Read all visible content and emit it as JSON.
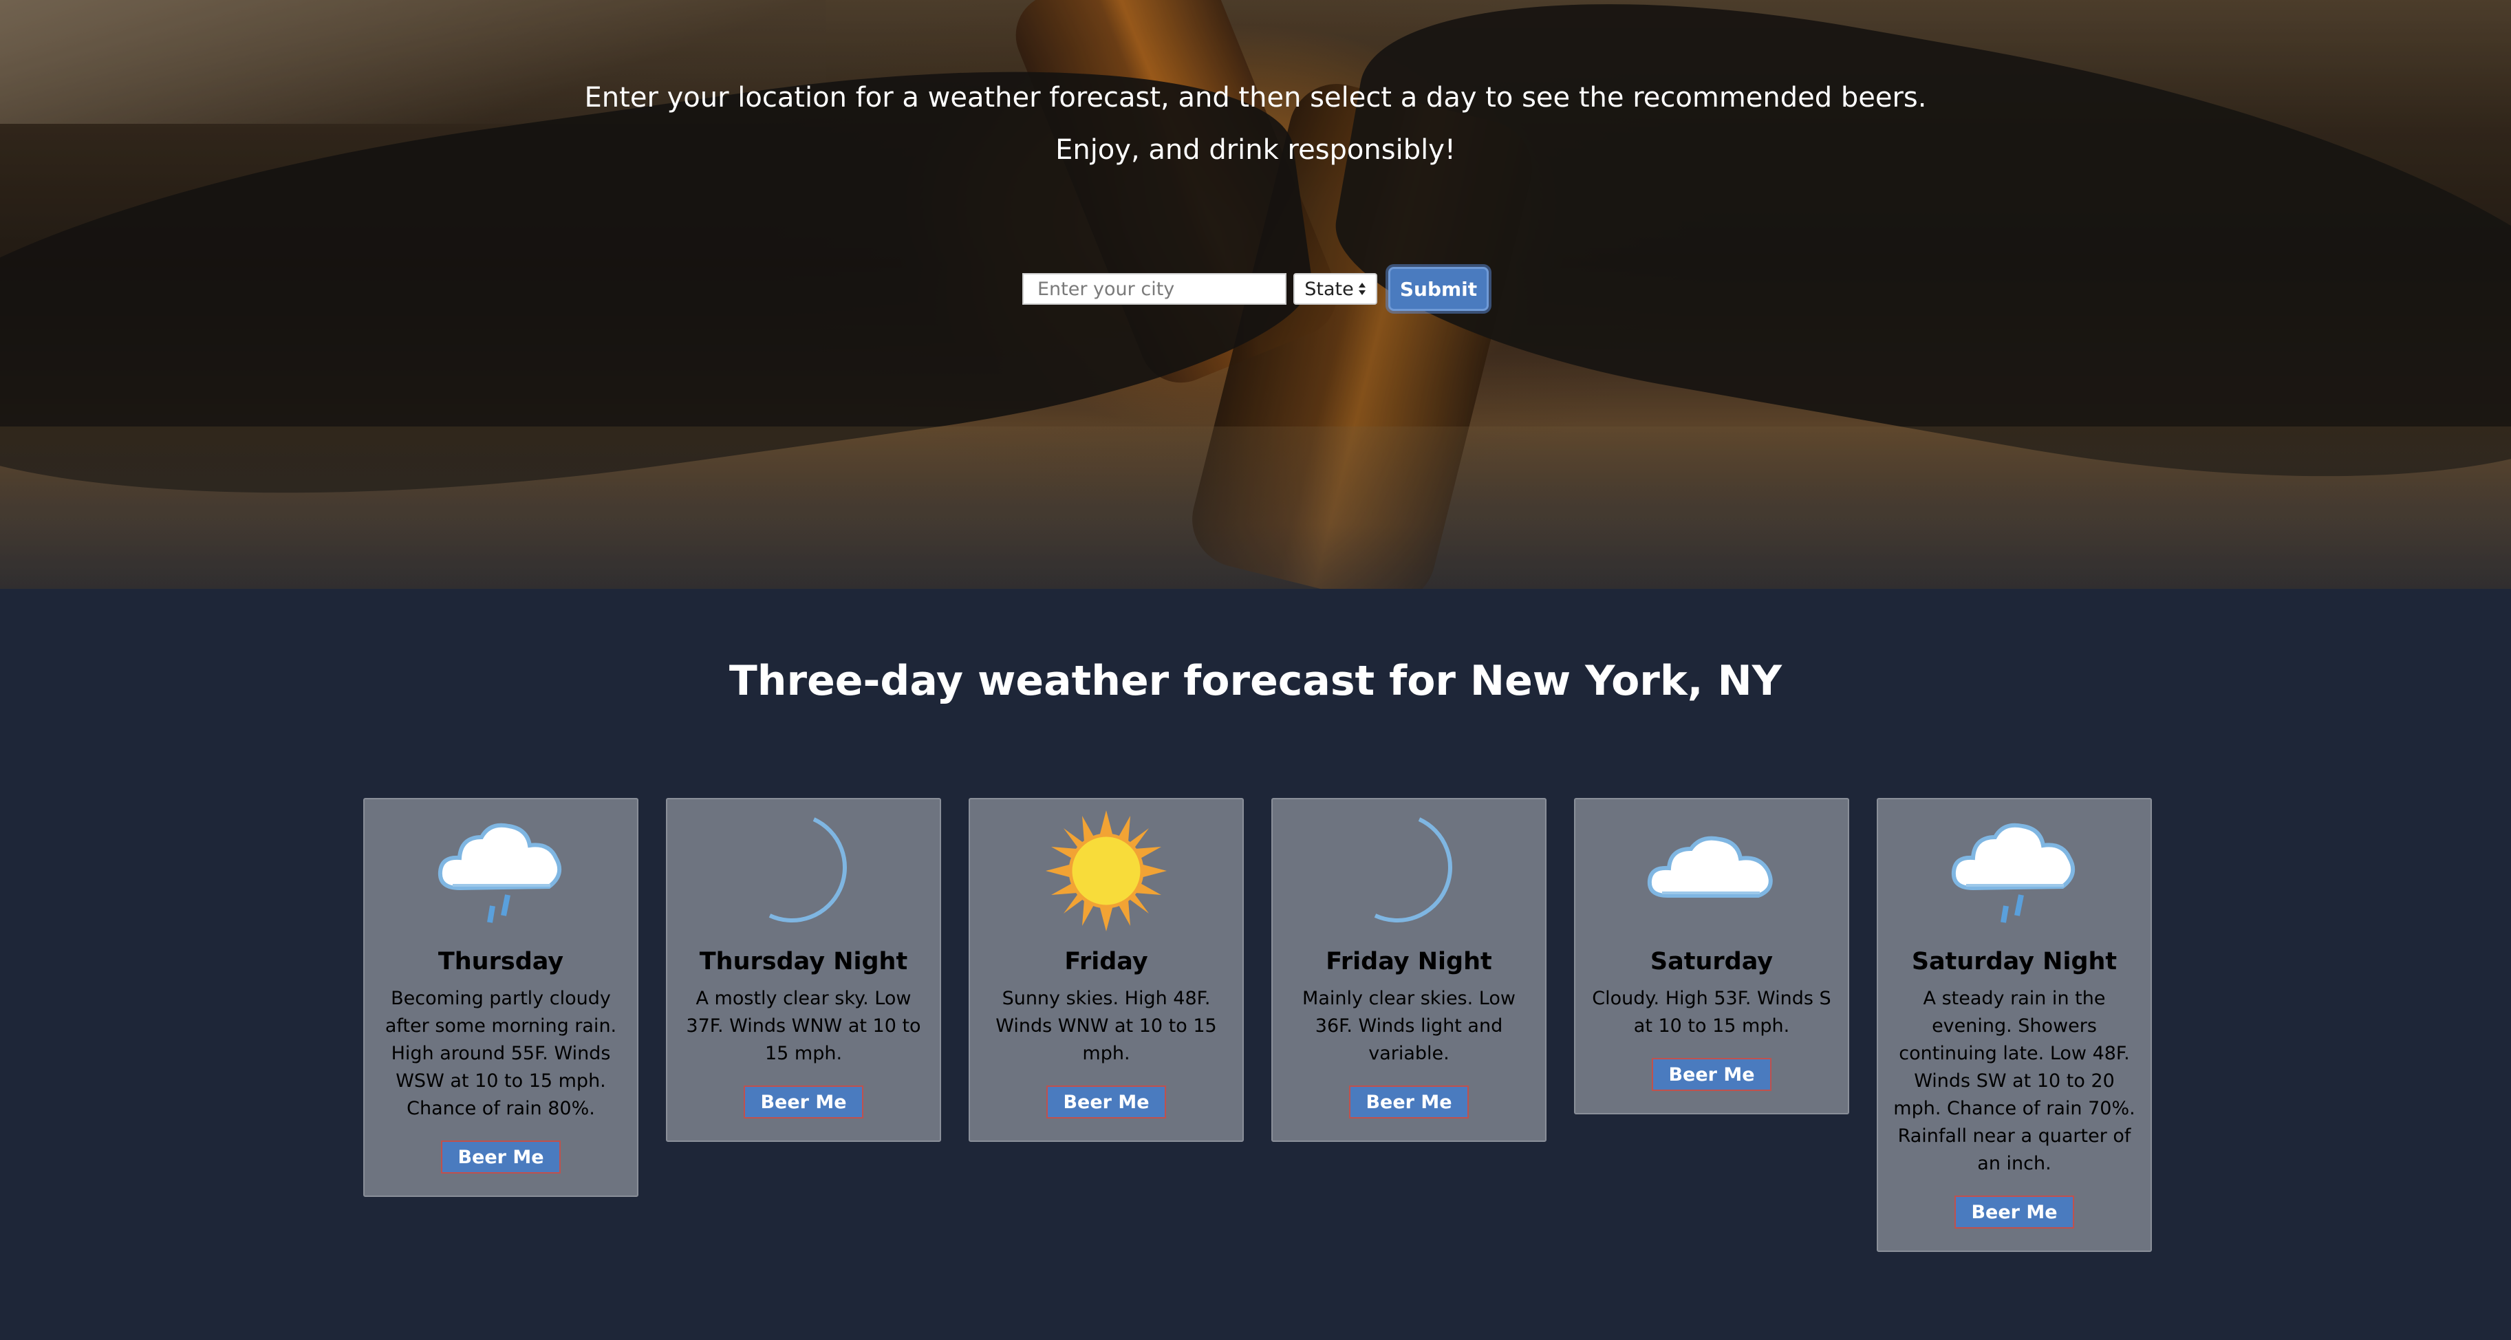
{
  "hero": {
    "line1": "Enter your location for a weather forecast, and then select a day to see the recommended beers.",
    "line2": "Enjoy, and drink responsibly!"
  },
  "search": {
    "city_placeholder": "Enter your city",
    "city_value": "",
    "state_label": "State",
    "submit_label": "Submit"
  },
  "forecast": {
    "title": "Three-day weather forecast for New York, NY",
    "beer_button_label": "Beer Me",
    "periods": [
      {
        "day": "Thursday",
        "icon": "rain-cloud-icon",
        "description": "Becoming partly cloudy after some morning rain. High around 55F. Winds WSW at 10 to 15 mph. Chance of rain 80%."
      },
      {
        "day": "Thursday Night",
        "icon": "moon-icon",
        "description": "A mostly clear sky. Low 37F. Winds WNW at 10 to 15 mph."
      },
      {
        "day": "Friday",
        "icon": "sun-icon",
        "description": "Sunny skies. High 48F. Winds WNW at 10 to 15 mph."
      },
      {
        "day": "Friday Night",
        "icon": "moon-icon",
        "description": "Mainly clear skies. Low 36F. Winds light and variable."
      },
      {
        "day": "Saturday",
        "icon": "cloud-icon",
        "description": "Cloudy. High 53F. Winds S at 10 to 15 mph."
      },
      {
        "day": "Saturday Night",
        "icon": "rain-cloud-icon",
        "description": "A steady rain in the evening. Showers continuing late. Low 48F. Winds SW at 10 to 20 mph. Chance of rain 70%. Rainfall near a quarter of an inch."
      }
    ]
  },
  "colors": {
    "page_background": "#1e2638",
    "card_background": "#6e7480",
    "button_blue": "#4a7bbf",
    "button_border_red": "#c0514d"
  }
}
